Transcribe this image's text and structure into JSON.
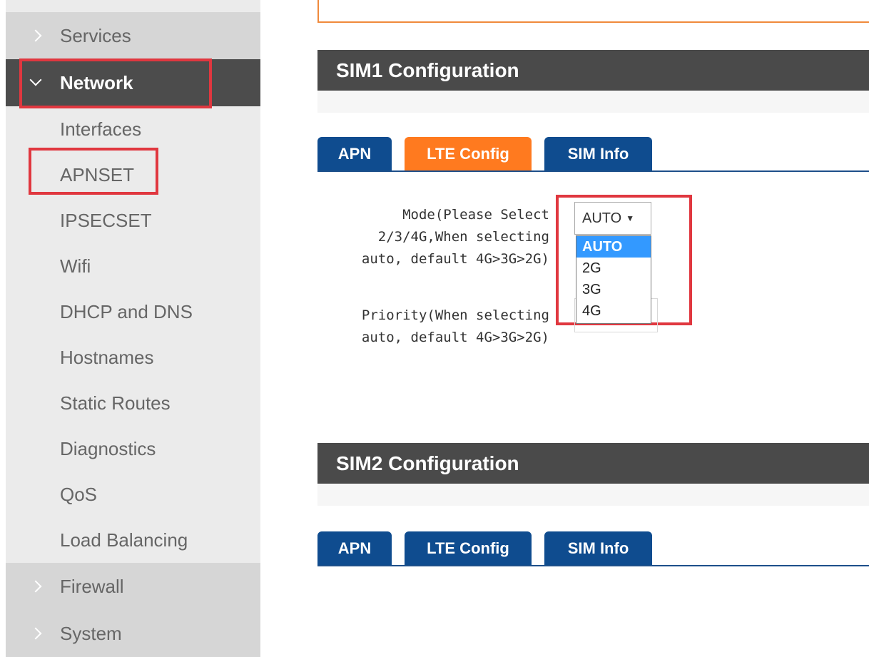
{
  "sidebar": {
    "services_label": "Services",
    "network_label": "Network",
    "sub_items": [
      "Interfaces",
      "APNSET",
      "IPSECSET",
      "Wifi",
      "DHCP and DNS",
      "Hostnames",
      "Static Routes",
      "Diagnostics",
      "QoS",
      "Load Balancing"
    ],
    "firewall_label": "Firewall",
    "system_label": "System"
  },
  "sim1": {
    "title": "SIM1 Configuration",
    "tabs": [
      "APN",
      "LTE Config",
      "SIM Info"
    ],
    "active_tab": "LTE Config",
    "mode_label_lines": [
      "Mode(Please Select",
      "2/3/4G,When selecting",
      "auto, default 4G>3G>2G)"
    ],
    "mode_value": "AUTO",
    "mode_options": [
      "AUTO",
      "2G",
      "3G",
      "4G"
    ],
    "priority_label_lines": [
      "Priority(When selecting",
      "auto, default 4G>3G>2G)"
    ]
  },
  "sim2": {
    "title": "SIM2 Configuration",
    "tabs": [
      "APN",
      "LTE Config",
      "SIM Info"
    ]
  },
  "colors": {
    "tab_blue": "#0f4c8f",
    "tab_orange": "#ff7a1f",
    "highlight_red": "#e0373f",
    "header_dark": "#4a4a4a",
    "sidebar_active": "#4c4c4c",
    "option_selected": "#3399ff"
  },
  "icons": {
    "collapsed": "chevron-right-icon",
    "expanded": "chevron-down-icon",
    "select_arrow": "triangle-down-icon"
  }
}
